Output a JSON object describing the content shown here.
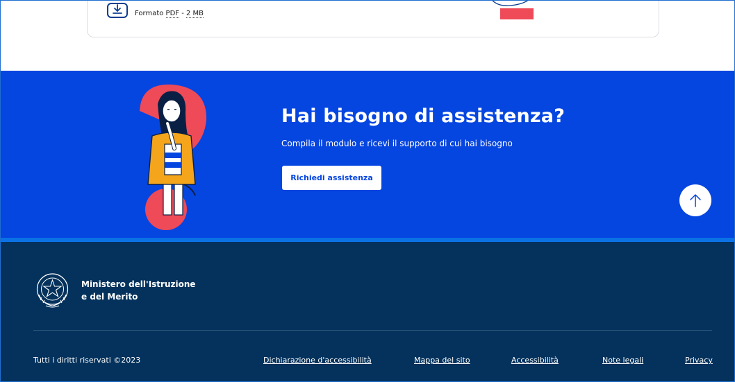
{
  "download": {
    "meta_prefix": "Formato ",
    "format": "PDF",
    "separator": " - ",
    "size": "2 MB"
  },
  "assist": {
    "title": "Hai bisogno di assistenza?",
    "subtitle": "Compila il modulo e ricevi il supporto di cui hai bisogno",
    "button_label": "Richiedi assistenza"
  },
  "footer": {
    "ministry_line1": "Ministero dell'Istruzione",
    "ministry_line2": "e del Merito",
    "copyright": "Tutti i diritti riservati ©2023",
    "links": [
      {
        "label": "Dichiarazione d'accessibilità"
      },
      {
        "label": "Mappa del sito"
      },
      {
        "label": "Accessibilità"
      },
      {
        "label": "Note legali"
      },
      {
        "label": "Privacy"
      }
    ]
  },
  "colors": {
    "banner_blue": "#0545e0",
    "footer_navy": "#04325c",
    "accent_red": "#ef4a57",
    "accent_yellow": "#f4a51c"
  },
  "icons": {
    "download": "download-icon",
    "back_to_top": "arrow-up-icon",
    "emblem": "italian-republic-emblem-icon"
  }
}
